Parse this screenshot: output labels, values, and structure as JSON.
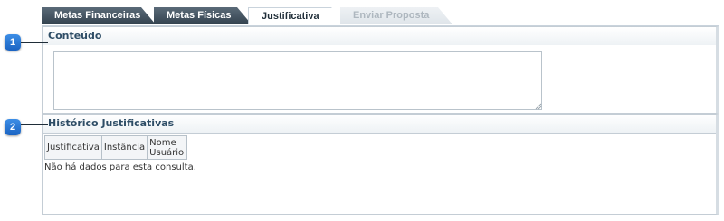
{
  "tabs": [
    {
      "label": "Metas Financeiras",
      "state": "inactive"
    },
    {
      "label": "Metas Físicas",
      "state": "inactive"
    },
    {
      "label": "Justificativa",
      "state": "active"
    },
    {
      "label": "Enviar Proposta",
      "state": "disabled"
    }
  ],
  "conteudo": {
    "title": "Conteúdo",
    "value": ""
  },
  "historico": {
    "title": "Histórico Justificativas",
    "columns": [
      "Justificativa",
      "Instância",
      "Nome Usuário"
    ],
    "empty_message": "Não há dados para esta consulta."
  },
  "callouts": [
    "1",
    "2"
  ],
  "colors": {
    "callout": "#2a78d6",
    "tab_dark": "#3f4e5b",
    "header_text": "#2e4d66"
  }
}
